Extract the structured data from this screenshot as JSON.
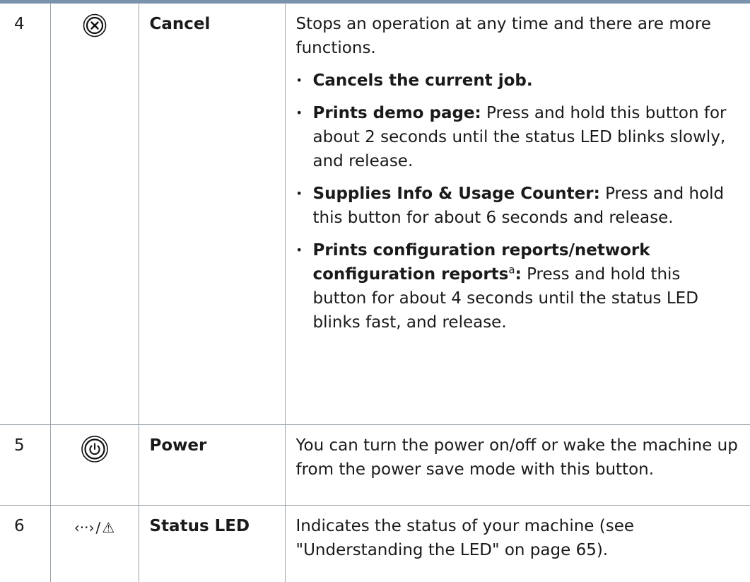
{
  "rows": [
    {
      "number": "4",
      "icon": "cancel-x-circle-icon",
      "name": "Cancel",
      "intro": "Stops an operation at any time and there are more functions.",
      "bullets": [
        {
          "bold": "Cancels the current job.",
          "text": ""
        },
        {
          "bold": "Prints demo page:",
          "text": " Press and hold this button for about 2 seconds until the status LED blinks slowly, and release."
        },
        {
          "bold": "Supplies Info & Usage Counter:",
          "text": " Press and hold this button for about 6 seconds and release."
        },
        {
          "bold": "Prints configuration reports/network configuration reports",
          "sup": "a",
          "bold_after": ":",
          "text": " Press and hold this button for about 4 seconds until the status LED blinks fast, and release."
        }
      ]
    },
    {
      "number": "5",
      "icon": "power-icon",
      "name": "Power",
      "description": "You can turn the power on/off or wake the machine up from the power save mode with this button."
    },
    {
      "number": "6",
      "icon": "status-led-icon",
      "icon_glyph_left": "‹··›",
      "icon_glyph_sep": "/",
      "icon_glyph_right": "⚠",
      "name": "Status LED",
      "description": "Indicates the status of your machine (see \"Understanding the LED\" on page 65)."
    }
  ]
}
